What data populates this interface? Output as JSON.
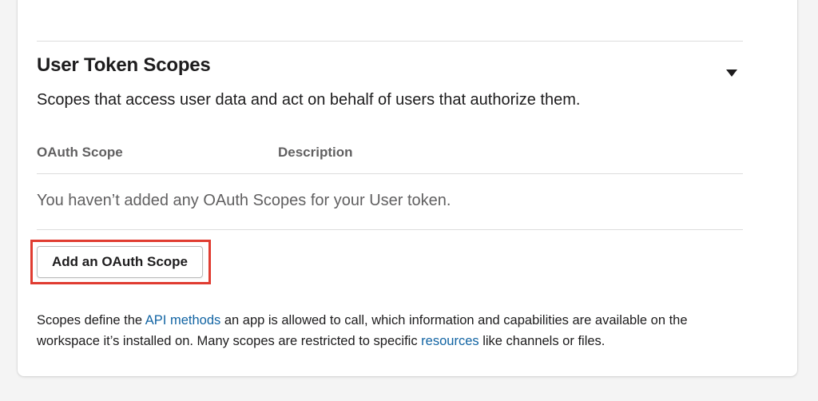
{
  "section": {
    "title": "User Token Scopes",
    "subtitle": "Scopes that access user data and act on behalf of users that authorize them."
  },
  "table": {
    "headers": [
      "OAuth Scope",
      "Description"
    ],
    "empty_message": "You haven’t added any OAuth Scopes for your User token."
  },
  "actions": {
    "add_scope_label": "Add an OAuth Scope"
  },
  "footnote": {
    "part1": "Scopes define the ",
    "link1": "API methods",
    "part2": " an app is allowed to call, which information and capabilities are available on the workspace it’s installed on. Many scopes are restricted to specific ",
    "link2": "resources",
    "part3": " like channels or files."
  },
  "icons": {
    "collapse_toggle": "caret-down-icon"
  },
  "colors": {
    "link": "#1264a3",
    "highlight": "#e03c31",
    "muted_text": "#616061"
  }
}
